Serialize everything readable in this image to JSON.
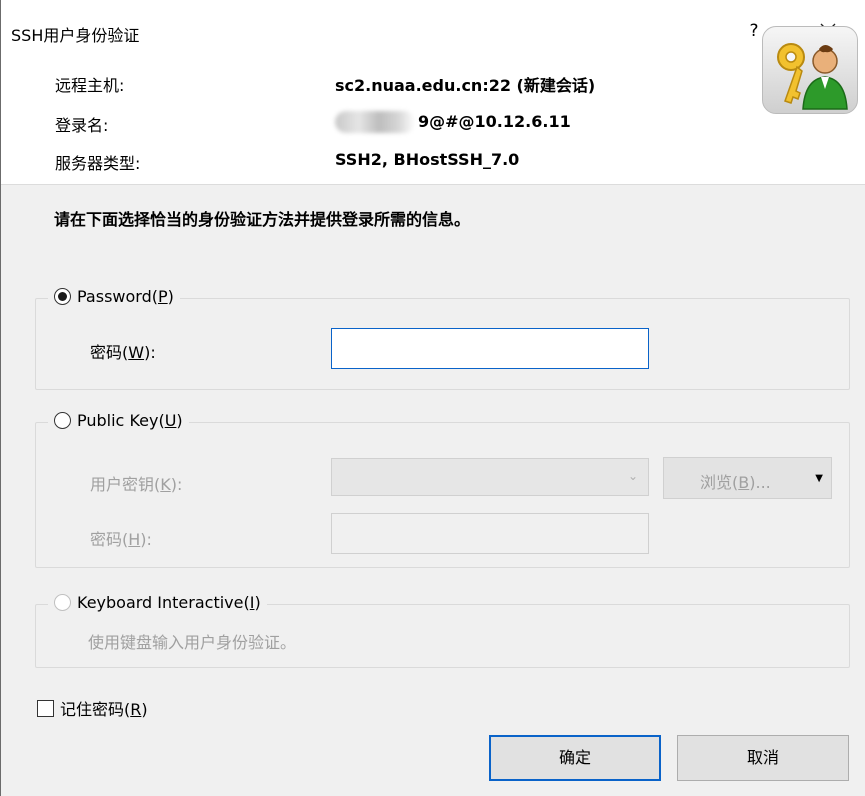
{
  "window": {
    "title": "SSH用户身份验证",
    "help_label": "?",
    "close_label": "×"
  },
  "info": {
    "host_label": "远程主机:",
    "host_value": "sc2.nuaa.edu.cn:22 (新建会话)",
    "login_label": "登录名:",
    "login_value": "9@#@10.12.6.11",
    "server_label": "服务器类型:",
    "server_value": "SSH2, BHostSSH_7.0"
  },
  "instruction": "请在下面选择恰当的身份验证方法并提供登录所需的信息。",
  "password_group": {
    "label_main": "Password(",
    "label_mnemonic": "P",
    "label_end": ")",
    "selected": true,
    "field_label_main": "密码(",
    "field_label_mnemonic": "W",
    "field_label_end": "):",
    "field_value": ""
  },
  "publickey_group": {
    "label_main": "Public Key(",
    "label_mnemonic": "U",
    "label_end": ")",
    "selected": false,
    "key_label_main": "用户密钥(",
    "key_label_mnemonic": "K",
    "key_label_end": "):",
    "key_value": "",
    "browse_main": "浏览(",
    "browse_mnemonic": "B",
    "browse_end": ")...",
    "pass_label_main": "密码(",
    "pass_label_mnemonic": "H",
    "pass_label_end": "):",
    "pass_value": ""
  },
  "keyboard_group": {
    "label_main": "Keyboard Interactive(",
    "label_mnemonic": "I",
    "label_end": ")",
    "selected": false,
    "description": "使用键盘输入用户身份验证。"
  },
  "remember": {
    "label_main": "记住密码(",
    "label_mnemonic": "R",
    "label_end": ")",
    "checked": false
  },
  "buttons": {
    "ok": "确定",
    "cancel": "取消"
  },
  "colors": {
    "accent": "#0a63c9",
    "panel": "#f0f0f0",
    "disabled_text": "#a0a0a0"
  }
}
